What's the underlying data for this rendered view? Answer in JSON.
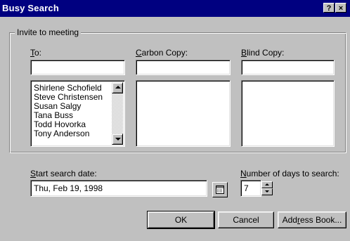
{
  "window": {
    "title": "Busy Search",
    "help_glyph": "?",
    "close_glyph": "×"
  },
  "group": {
    "legend": "Invite to meeting"
  },
  "to": {
    "label_mnemonic": "T",
    "label_rest": "o:",
    "value": "",
    "list": [
      "Shirlene Schofield",
      "Steve Christensen",
      "Susan Salgy",
      "Tana Buss",
      "Todd Hovorka",
      "Tony Anderson"
    ]
  },
  "cc": {
    "label_mnemonic": "C",
    "label_rest": "arbon Copy:",
    "value": ""
  },
  "bcc": {
    "label_mnemonic": "B",
    "label_rest": "lind Copy:",
    "value": ""
  },
  "start_date": {
    "label_mnemonic": "S",
    "label_rest": "tart search date:",
    "value": "Thu, Feb 19, 1998"
  },
  "days": {
    "label_pre": "",
    "label_mnemonic": "N",
    "label_rest": "umber of days to search:",
    "value": "7"
  },
  "buttons": {
    "ok": "OK",
    "cancel": "Cancel",
    "address_pre": "Add",
    "address_mnemonic": "r",
    "address_rest": "ess Book..."
  },
  "icons": {
    "calendar": "calendar-icon",
    "scroll_up": "scroll-up-arrow-icon",
    "scroll_down": "scroll-down-arrow-icon"
  }
}
